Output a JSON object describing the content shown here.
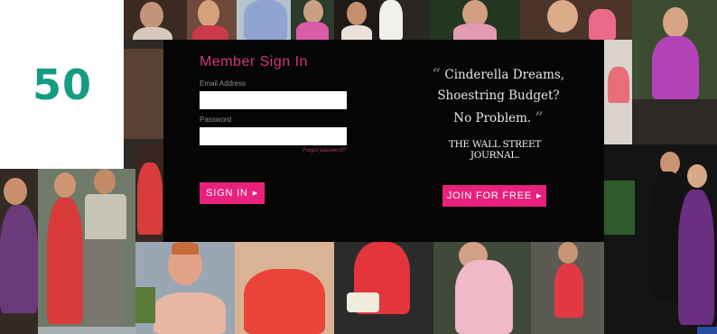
{
  "badge": {
    "number": "50"
  },
  "signin": {
    "title": "Member Sign In",
    "email_label": "Email Address",
    "email_value": "",
    "password_label": "Password",
    "password_value": "",
    "forgot_label": "Forgot password?",
    "button_label": "SIGN IN",
    "button_arrow": "▶"
  },
  "promo": {
    "quote_open": "“",
    "quote_line1": "Cinderella Dreams,",
    "quote_line2": "Shoestring Budget?",
    "quote_line3": "No Problem.",
    "quote_close": "”",
    "source": "THE WALL STREET JOURNAL.",
    "join_label": "JOIN FOR FREE",
    "join_arrow": "▶"
  },
  "colors": {
    "accent_pink": "#e8217c",
    "title_pink": "#d2357e",
    "badge_green": "#159c83",
    "modal_bg": "#050505"
  }
}
